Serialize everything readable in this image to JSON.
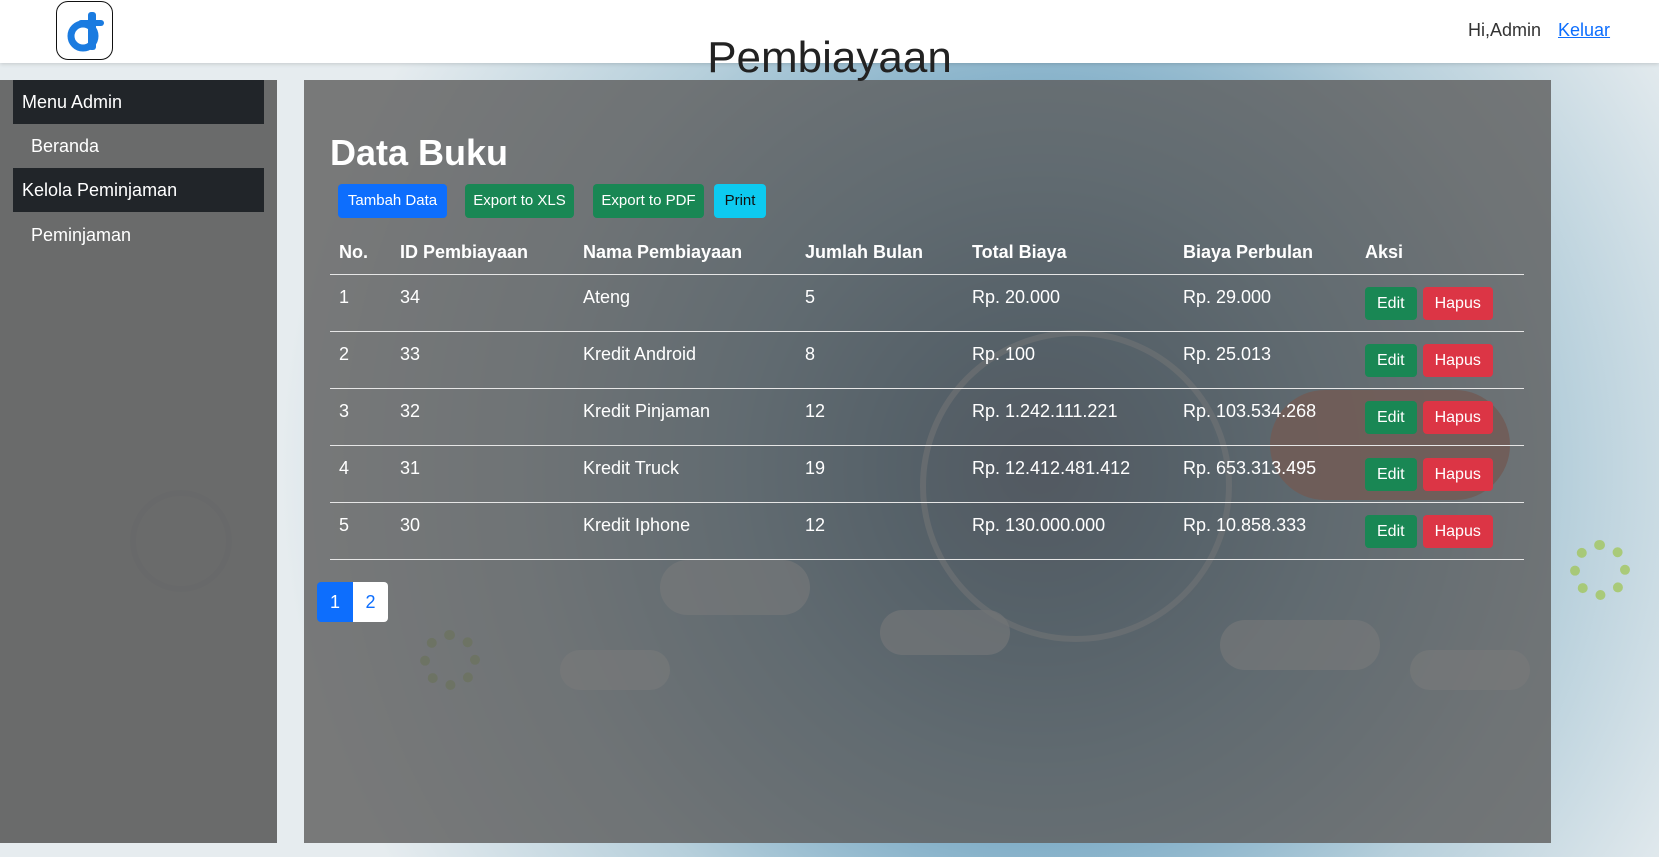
{
  "header": {
    "title": "Pembiayaan",
    "greeting": "Hi,Admin",
    "logout_label": "Keluar"
  },
  "sidebar": {
    "sections": [
      {
        "label": "Menu Admin",
        "items": [
          {
            "label": "Beranda"
          }
        ]
      },
      {
        "label": "Kelola Peminjaman",
        "items": [
          {
            "label": "Peminjaman"
          }
        ]
      }
    ]
  },
  "main": {
    "title": "Data Buku",
    "actions": {
      "add_label": "Tambah Data",
      "xls_label": "Export to XLS",
      "pdf_label": "Export to PDF",
      "print_label": "Print"
    },
    "table": {
      "headers": [
        "No.",
        "ID Pembiayaan",
        "Nama Pembiayaan",
        "Jumlah Bulan",
        "Total Biaya",
        "Biaya Perbulan",
        "Aksi"
      ],
      "rows": [
        {
          "no": "1",
          "id": "34",
          "name": "Ateng",
          "months": "5",
          "total": "Rp. 20.000",
          "monthly": "Rp. 29.000"
        },
        {
          "no": "2",
          "id": "33",
          "name": "Kredit Android",
          "months": "8",
          "total": "Rp. 100",
          "monthly": "Rp. 25.013"
        },
        {
          "no": "3",
          "id": "32",
          "name": "Kredit Pinjaman",
          "months": "12",
          "total": "Rp. 1.242.111.221",
          "monthly": "Rp. 103.534.268"
        },
        {
          "no": "4",
          "id": "31",
          "name": "Kredit Truck",
          "months": "19",
          "total": "Rp. 12.412.481.412",
          "monthly": "Rp. 653.313.495"
        },
        {
          "no": "5",
          "id": "30",
          "name": "Kredit Iphone",
          "months": "12",
          "total": "Rp. 130.000.000",
          "monthly": "Rp. 10.858.333"
        }
      ],
      "edit_label": "Edit",
      "delete_label": "Hapus"
    },
    "pagination": {
      "pages": [
        "1",
        "2"
      ],
      "current": "1"
    }
  },
  "colors": {
    "primary": "#0d6efd",
    "success": "#198754",
    "danger": "#dc3545",
    "info": "#0dcaf0",
    "sidebar_header": "#212529"
  },
  "icons": {
    "logo": "app-logo-icon"
  }
}
